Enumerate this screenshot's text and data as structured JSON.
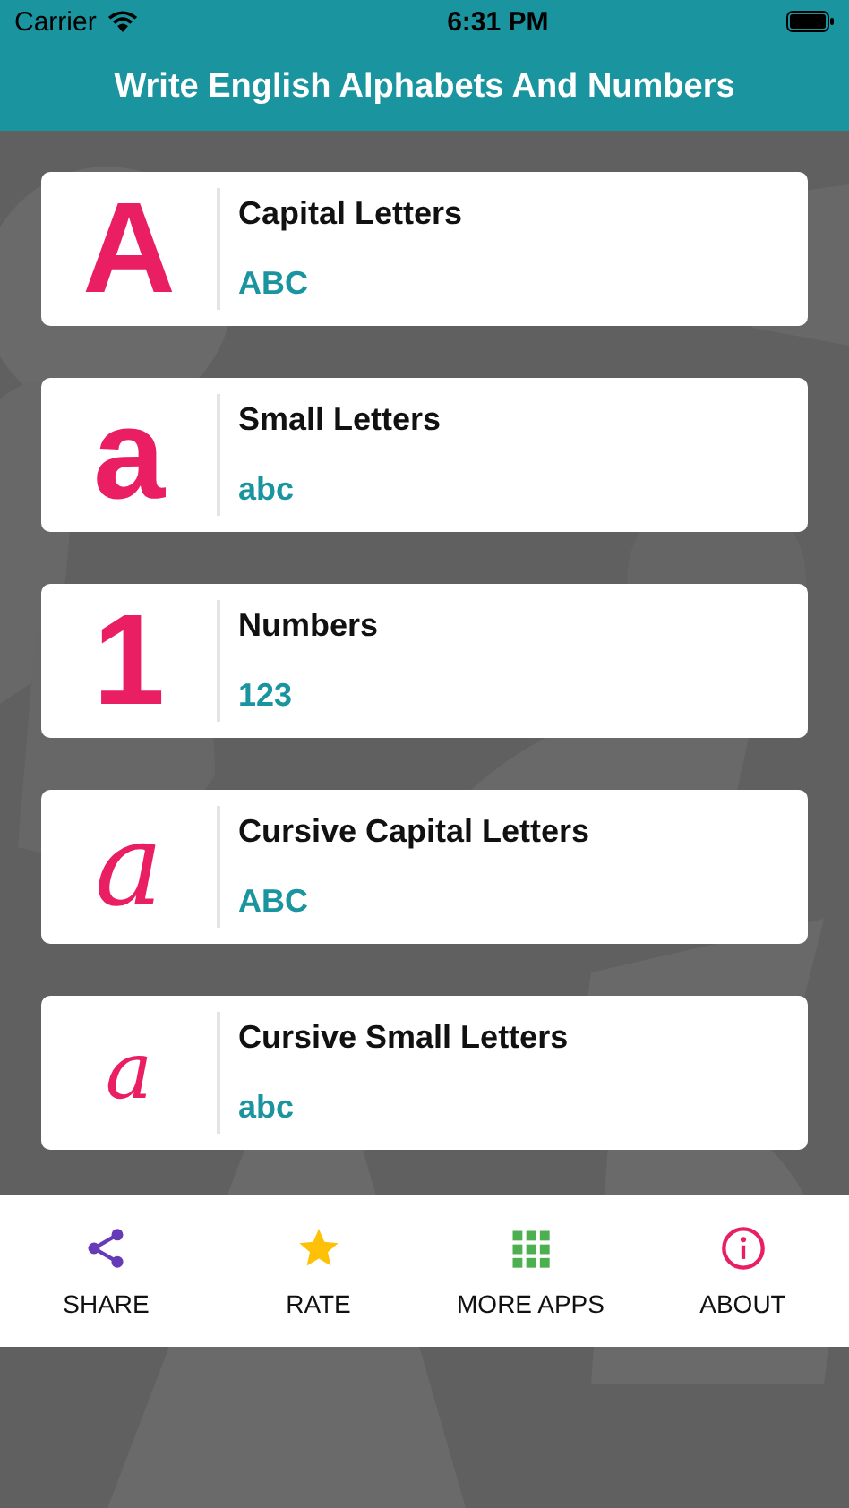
{
  "status_bar": {
    "carrier": "Carrier",
    "time": "6:31 PM"
  },
  "header": {
    "title": "Write English Alphabets And Numbers"
  },
  "cards": [
    {
      "glyph": "A",
      "kind": "print",
      "title": "Capital Letters",
      "subtitle": "ABC"
    },
    {
      "glyph": "a",
      "kind": "print",
      "title": "Small Letters",
      "subtitle": "abc"
    },
    {
      "glyph": "1",
      "kind": "print",
      "title": "Numbers",
      "subtitle": "123"
    },
    {
      "glyph": "a",
      "kind": "cursive",
      "title": "Cursive Capital Letters",
      "subtitle": "ABC"
    },
    {
      "glyph": "a",
      "kind": "cursivesmall",
      "title": "Cursive Small Letters",
      "subtitle": "abc"
    }
  ],
  "bottom_bar": [
    {
      "label": "SHARE",
      "color": "#673ab7"
    },
    {
      "label": "RATE",
      "color": "#ffc107"
    },
    {
      "label": "MORE APPS",
      "color": "#4caf50"
    },
    {
      "label": "ABOUT",
      "color": "#e91e63"
    }
  ]
}
